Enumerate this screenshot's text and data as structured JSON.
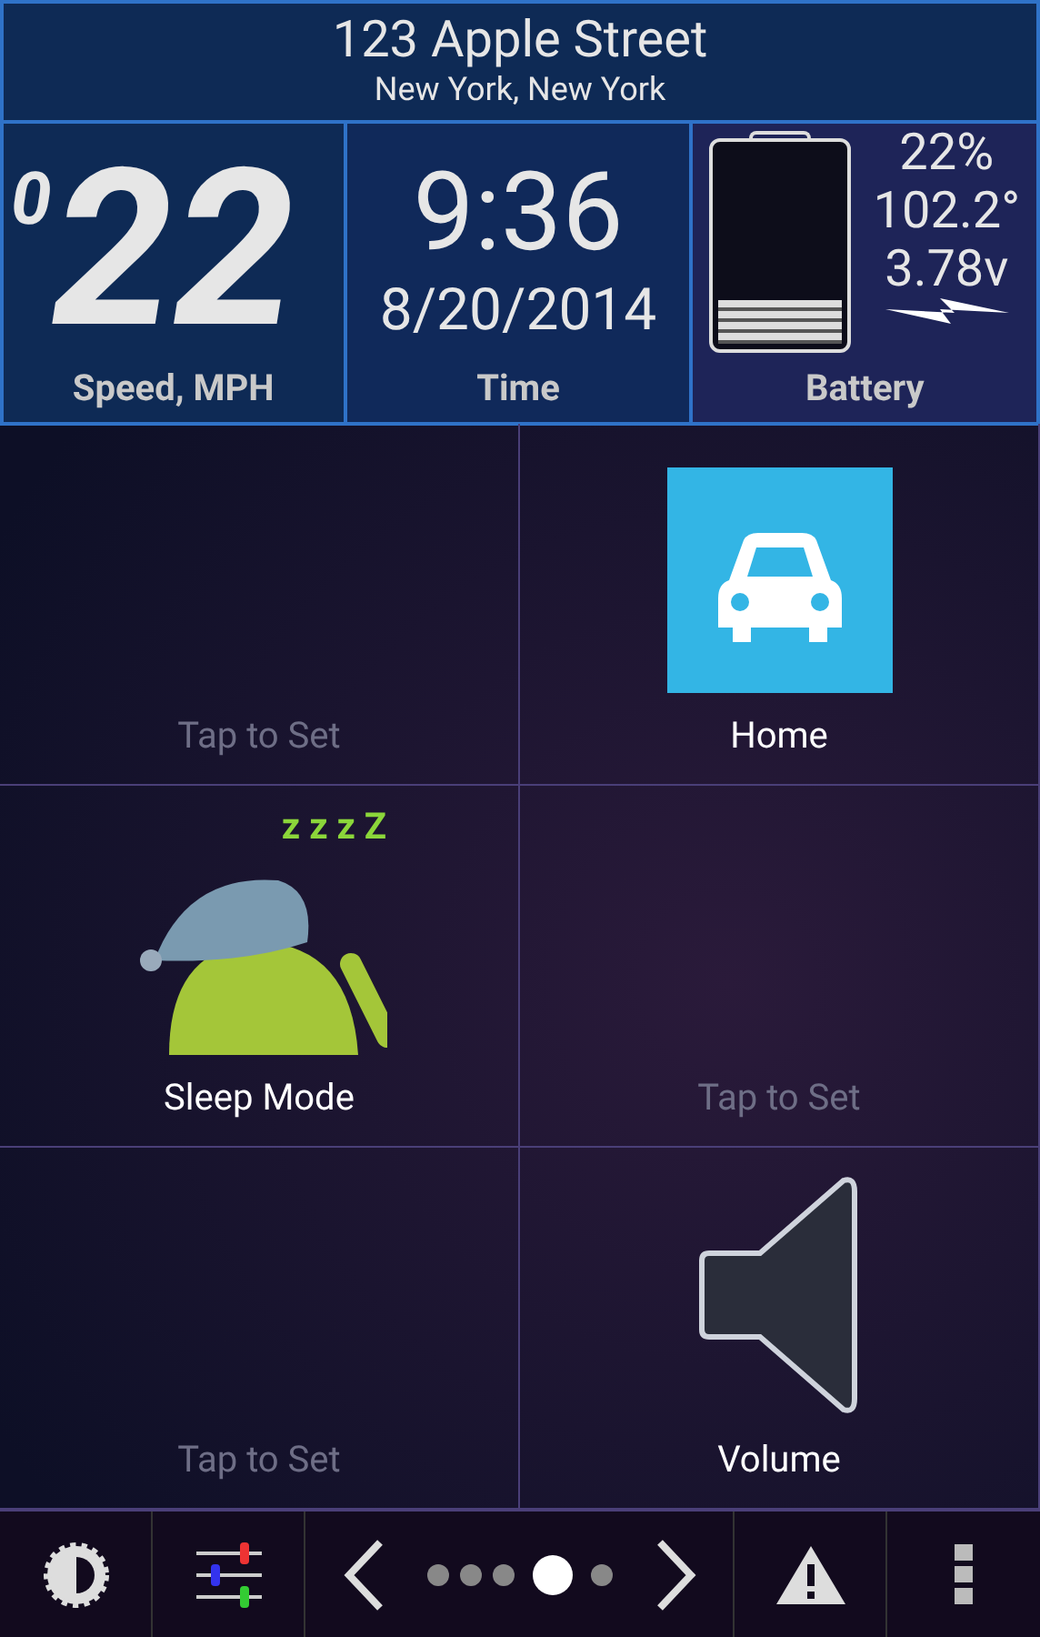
{
  "address": {
    "street": "123 Apple Street",
    "city": "New York, New York"
  },
  "speed": {
    "prefix": "0",
    "value": "22",
    "label": "Speed, MPH"
  },
  "time": {
    "clock": "9:36",
    "date": "8/20/2014",
    "label": "Time"
  },
  "battery": {
    "level": 0.22,
    "percent": "22%",
    "temperature": "102.2°",
    "voltage": "3.78v",
    "charging": true,
    "label": "Battery"
  },
  "tiles": [
    {
      "kind": "empty",
      "label": "Tap to Set"
    },
    {
      "kind": "car",
      "label": "Home"
    },
    {
      "kind": "sleep",
      "label": "Sleep Mode",
      "zzz": "z z z Z"
    },
    {
      "kind": "empty",
      "label": "Tap to Set"
    },
    {
      "kind": "empty",
      "label": "Tap to Set"
    },
    {
      "kind": "volume",
      "label": "Volume"
    }
  ],
  "pages": [
    {
      "selected": false
    },
    {
      "selected": false
    },
    {
      "selected": false
    },
    {
      "selected": true
    },
    {
      "selected": false
    }
  ]
}
